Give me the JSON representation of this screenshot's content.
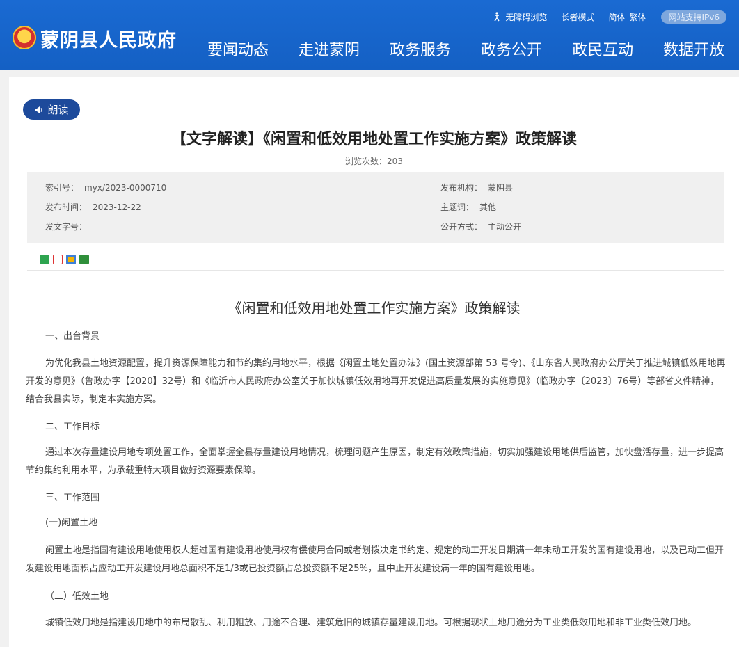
{
  "header": {
    "site_title": "蒙阴县人民政府",
    "topbar": {
      "accessibility": "无障碍浏览",
      "elder_mode": "长者模式",
      "simplified": "简体",
      "traditional": "繁体",
      "ipv6": "网站支持IPv6"
    },
    "nav": [
      "要闻动态",
      "走进蒙阴",
      "政务服务",
      "政务公开",
      "政民互动",
      "数据开放"
    ]
  },
  "article": {
    "read_label": "朗读",
    "title": "【文字解读】《闲置和低效用地处置工作实施方案》政策解读",
    "views": "浏览次数：203",
    "meta": {
      "index_label": "索引号：",
      "index_value": "myx/2023-0000710",
      "publish_time_label": "发布时间：",
      "publish_time_value": "2023-12-22",
      "doc_no_label": "发文字号：",
      "doc_no_value": "",
      "agency_label": "发布机构：",
      "agency_value": "蒙阴县",
      "subject_label": "主题词：",
      "subject_value": "其他",
      "disclosure_label": "公开方式：",
      "disclosure_value": "主动公开"
    },
    "body_title": "《闲置和低效用地处置工作实施方案》政策解读",
    "paragraphs": [
      "一、出台背景",
      "为优化我县土地资源配置，提升资源保障能力和节约集约用地水平，根据《闲置土地处置办法》(国土资源部第 53 号令)、《山东省人民政府办公厅关于推进城镇低效用地再开发的意见》（鲁政办字【2020】32号）和《临沂市人民政府办公室关于加快城镇低效用地再开发促进高质量发展的实施意见》（临政办字〔2023〕76号）等部省文件精神，结合我县实际，制定本实施方案。",
      "二、工作目标",
      "通过本次存量建设用地专项处置工作，全面掌握全县存量建设用地情况，梳理问题产生原因，制定有效政策措施，切实加强建设用地供后监管，加快盘活存量，进一步提高节约集约利用水平，为承载重特大项目做好资源要素保障。",
      "三、工作范围",
      "(一)闲置土地",
      "闲置土地是指国有建设用地使用权人超过国有建设用地使用权有偿使用合同或者划拨决定书约定、规定的动工开发日期满一年未动工开发的国有建设用地，以及已动工但开发建设用地面积占应动工开发建设用地总面积不足1/3或已投资额占总投资额不足25%，且中止开发建设满一年的国有建设用地。",
      "（二）低效土地",
      "城镇低效用地是指建设用地中的布局散乱、利用粗放、用途不合理、建筑危旧的城镇存量建设用地。可根据现状土地用途分为工业类低效用地和非工业类低效用地。"
    ]
  },
  "colors": {
    "header_blue": "#1565c0",
    "read_button": "#1d4a9b",
    "meta_bg": "#f0f0f0"
  },
  "share_icons": [
    "wechat-icon",
    "weibo-icon",
    "qzone-icon",
    "douban-icon"
  ]
}
